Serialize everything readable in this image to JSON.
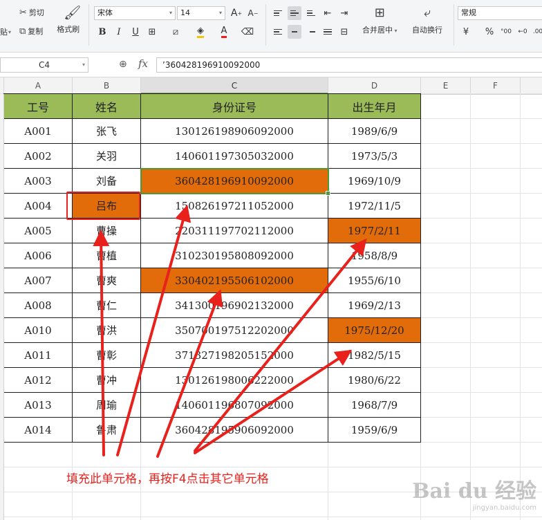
{
  "ribbon": {
    "paste_label": "贴",
    "cut_label": "剪切",
    "copy_label": "复制",
    "format_painter_label": "格式刷",
    "font_name": "宋体",
    "font_size": "14",
    "merge_center_label": "合并居中",
    "wrap_text_label": "自动换行",
    "number_format": "常规",
    "currency_symbol": "¥",
    "percent_symbol": "%"
  },
  "formula_bar": {
    "name_box": "C4",
    "fx_label": "fx",
    "formula": "’360428196910092000"
  },
  "columns": [
    "A",
    "B",
    "C",
    "D",
    "E",
    "F"
  ],
  "table": {
    "headers": [
      "工号",
      "姓名",
      "身份证号",
      "出生年月"
    ],
    "rows": [
      [
        "A001",
        "张飞",
        "130126198906092000",
        "1989/6/9"
      ],
      [
        "A002",
        "关羽",
        "140601197305032000",
        "1973/5/3"
      ],
      [
        "A003",
        "刘备",
        "360428196910092000",
        "1969/10/9"
      ],
      [
        "A004",
        "吕布",
        "150826197211052000",
        "1972/11/5"
      ],
      [
        "A005",
        "曹操",
        "220311197702112000",
        "1977/2/11"
      ],
      [
        "A006",
        "曹植",
        "310230195808092000",
        "1958/8/9"
      ],
      [
        "A007",
        "曹爽",
        "330402195506102000",
        "1955/6/10"
      ],
      [
        "A008",
        "曹仁",
        "341300196902132000",
        "1969/2/13"
      ],
      [
        "A010",
        "曹洪",
        "350700197512202000",
        "1975/12/20"
      ],
      [
        "A011",
        "曹彰",
        "371327198205152000",
        "1982/5/15"
      ],
      [
        "A012",
        "曹冲",
        "130126198006222000",
        "1980/6/22"
      ],
      [
        "A013",
        "周瑜",
        "140601196807092000",
        "1968/7/9"
      ],
      [
        "A014",
        "鲁肃",
        "360428195906092000",
        "1959/6/9"
      ]
    ],
    "highlight_color": "#e26b0a",
    "header_color": "#9bbb59"
  },
  "annotation": {
    "text": "填充此单元格，再按F4点击其它单元格",
    "color": "#e8211c"
  },
  "watermark": {
    "brand": "Bai du 经验",
    "url": "jingyan.baidu.com"
  }
}
